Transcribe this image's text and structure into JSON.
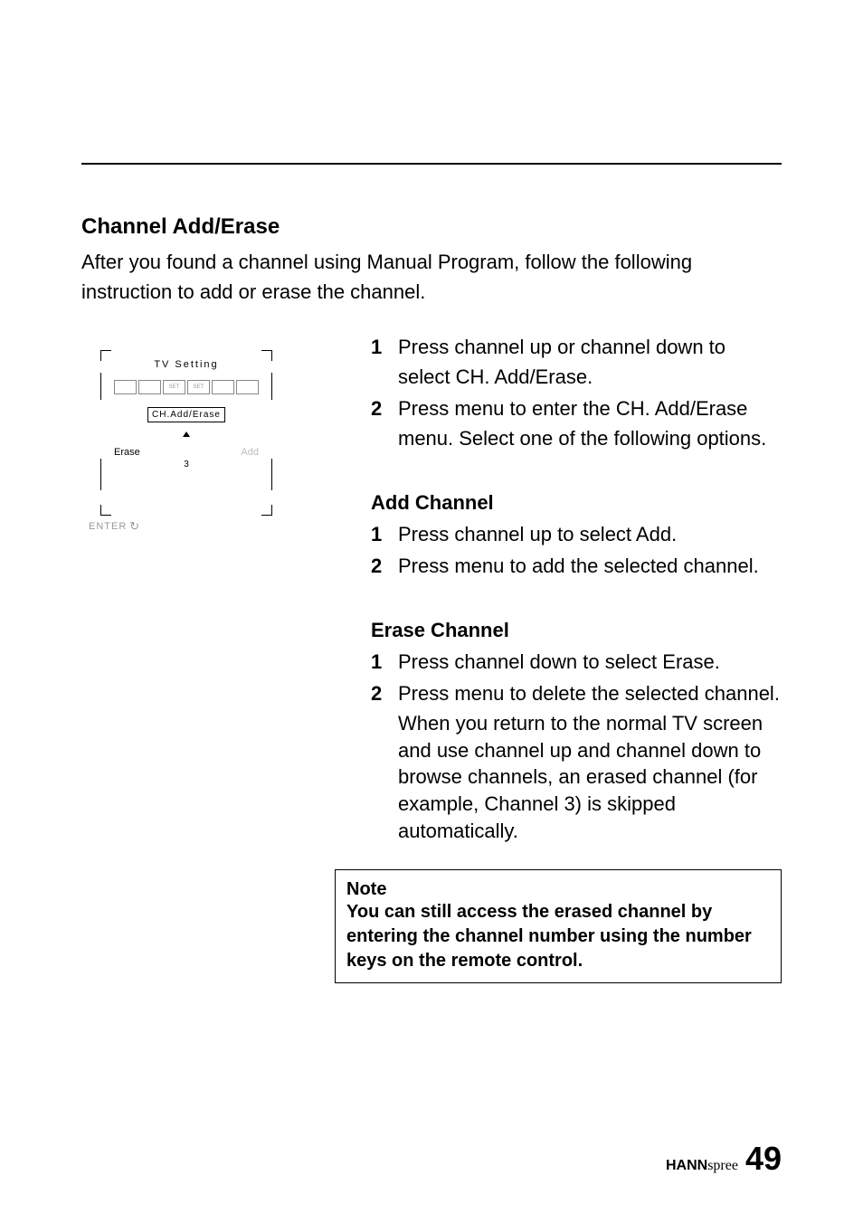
{
  "section_title": "Channel Add/Erase",
  "intro_text": "After you found a channel using Manual Program, follow the following instruction to add or erase the channel.",
  "diagram": {
    "header": "TV   Setting",
    "icon_labels": [
      "",
      "",
      "SET",
      "SET",
      "",
      ""
    ],
    "menu_label": "CH.Add/Erase",
    "left_action": "Erase",
    "right_action": "Add",
    "channel_number": "3",
    "enter_label": "ENTER"
  },
  "main_steps": [
    "Press channel up or channel down to select CH. Add/Erase.",
    "Press menu to enter the CH. Add/Erase menu. Select one of the following options."
  ],
  "add_section": {
    "title": "Add Channel",
    "steps": [
      "Press channel up to select Add.",
      "Press menu to add the selected channel."
    ]
  },
  "erase_section": {
    "title": "Erase Channel",
    "steps": [
      "Press channel down to select Erase.",
      "Press menu to delete the selected channel."
    ],
    "after_text": "When you return to the normal TV screen and use channel up and channel down to browse channels, an erased channel (for example, Channel 3) is skipped automatically."
  },
  "note": {
    "title": "Note",
    "body": "You can still access the erased channel by entering the channel number using the number keys on the remote control."
  },
  "footer": {
    "brand_part1": "HANN",
    "brand_part2": "spree",
    "page_number": "49"
  }
}
